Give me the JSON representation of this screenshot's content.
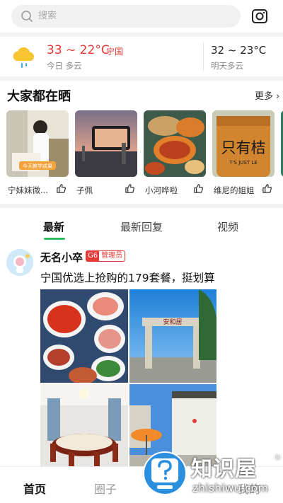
{
  "search": {
    "placeholder": "搜索"
  },
  "weather": {
    "today_temp": "33 ~ 22°C",
    "city": "宁国",
    "today_label": "今日 多云",
    "tomorrow_temp": "32 ~ 23°C",
    "tomorrow_label": "明天多云",
    "accent_color": "#e53935"
  },
  "share_section": {
    "title": "大家都在晒",
    "more_label": "更多",
    "cards": [
      {
        "name": "宁妹妹微..."
      },
      {
        "name": "子佩"
      },
      {
        "name": "小河哗啦"
      },
      {
        "name": "维尼的姐姐"
      }
    ],
    "card1_overlay": "今天教学成果",
    "card4_overlay_big": "只有桔",
    "card4_overlay_small": "T'S JUST LE"
  },
  "tabs": [
    {
      "label": "最新"
    },
    {
      "label": "最新回复"
    },
    {
      "label": "视频"
    }
  ],
  "post": {
    "author": "无名小卒",
    "badge_level": "G6",
    "badge_role": "管理员",
    "text": "宁国优选上抢购的179套餐，挺划算",
    "gate_sign": "安和居"
  },
  "bottom_nav": [
    {
      "label": "首页"
    },
    {
      "label": "圈子"
    },
    {
      "label": "我的"
    }
  ],
  "watermark": {
    "brand": "知识屋",
    "registered": "®",
    "url": "zhishiwu.com"
  },
  "colors": {
    "green_accent": "#2fbf5b",
    "red": "#e53935"
  }
}
